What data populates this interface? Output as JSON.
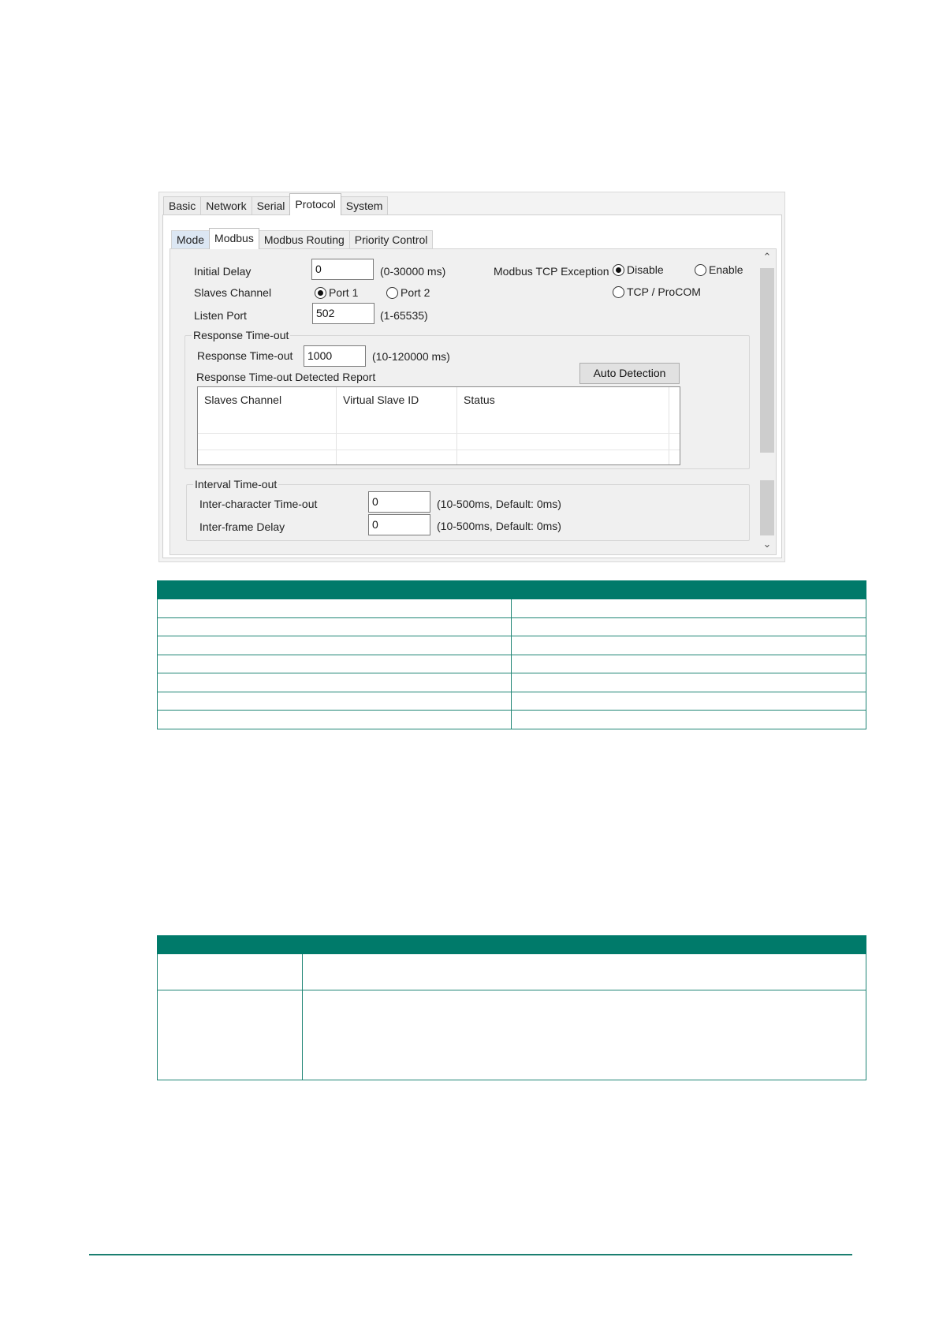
{
  "dialog": {
    "tabs": [
      "Basic",
      "Network",
      "Serial",
      "Protocol",
      "System"
    ],
    "active_tab": "Protocol",
    "subtabs": [
      "Mode",
      "Modbus",
      "Modbus Routing",
      "Priority Control"
    ],
    "active_subtab": "Modbus",
    "initial_delay": {
      "label": "Initial Delay",
      "value": "0",
      "range": "(0-30000 ms)"
    },
    "slaves_channel": {
      "label": "Slaves Channel",
      "port1": "Port 1",
      "port2": "Port 2",
      "selected": "Port 1"
    },
    "listen_port": {
      "label": "Listen Port",
      "value": "502",
      "range": "(1-65535)"
    },
    "modbus_tcp_exception": {
      "label": "Modbus TCP Exception",
      "disable": "Disable",
      "enable": "Enable",
      "tcp_procom": "TCP / ProCOM",
      "selected": "Disable"
    },
    "response_timeout_group": {
      "legend": "Response Time-out",
      "label": "Response Time-out",
      "value": "1000",
      "range": "(10-120000 ms)",
      "report_label": "Response Time-out Detected Report",
      "auto_detection": "Auto Detection",
      "columns": [
        "Slaves Channel",
        "Virtual Slave ID",
        "Status"
      ]
    },
    "interval_timeout_group": {
      "legend": "Interval Time-out",
      "inter_char": {
        "label": "Inter-character Time-out",
        "value": "0",
        "range": "(10-500ms, Default: 0ms)"
      },
      "inter_frame": {
        "label": "Inter-frame Delay",
        "value": "0",
        "range": "(10-500ms, Default: 0ms)"
      }
    }
  },
  "colors": {
    "table_header": "#007a6a",
    "footer_line": "#1b7f70"
  }
}
